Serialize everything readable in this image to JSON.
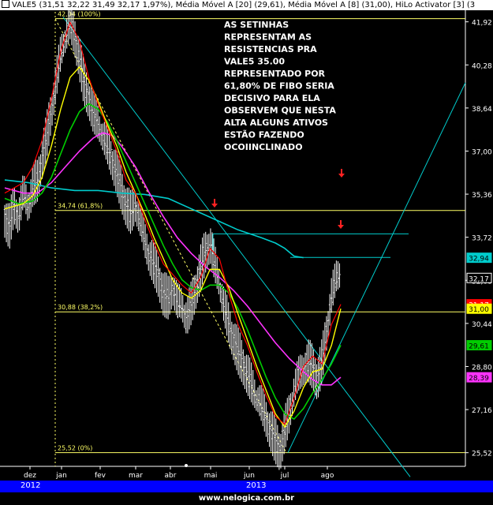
{
  "header": {
    "text": "VALE5 (31,51  32,22  31,49  32,17  1,97%), Média Móvel A [20] (29,61), Média Móvel A [8] (31,00), HiLo Activator [3] (3"
  },
  "annotation": {
    "lines": [
      "AS SETINHAS",
      "REPRESENTAM AS",
      "RESISTENCIAS PRA",
      "VALE5 35.00",
      "REPRESENTADO POR",
      "61,80% DE FIBO SERIA",
      "DECISIVO PARA ELA",
      "OBSERVEM QUE NESTA",
      "ALTA ALGUNS ATIVOS",
      "ESTÃO FAZENDO",
      "OCOIINCLINADO"
    ]
  },
  "year_bar": {
    "left": "2012",
    "center": "2013"
  },
  "footer": {
    "text": "www.nelogica.com.br"
  },
  "colors": {
    "price": "#ffffff",
    "hilo": "#ff0000",
    "ma8": "#ffff00",
    "ma20": "#00cc00",
    "ma_long": "#ff33ff",
    "ma_very_long": "#00cccc",
    "trend": "#00cccc",
    "fibo": "#ffff66",
    "arrow": "#ff2222"
  },
  "chart_data": {
    "type": "line",
    "ylim": [
      25.0,
      42.3
    ],
    "y_ticks": [
      "41,92",
      "40,28",
      "38,64",
      "37,00",
      "35,36",
      "33,72",
      "32,08",
      "30,44",
      "28,80",
      "27,16",
      "25,52"
    ],
    "y_tick_values": [
      41.92,
      40.28,
      38.64,
      37.0,
      35.36,
      33.72,
      32.08,
      30.44,
      28.8,
      27.16,
      25.52
    ],
    "x_ticks": [
      "dez",
      "jan",
      "fev",
      "mar",
      "abr",
      "mai",
      "jun",
      "jul",
      "ago"
    ],
    "price_tags": [
      {
        "label": "32,94",
        "value": 32.94,
        "bg": "#00cccc",
        "fg": "#000000"
      },
      {
        "label": "32,17",
        "value": 32.17,
        "bg": "#000000",
        "fg": "#ffffff"
      },
      {
        "label": "31,17",
        "value": 31.17,
        "bg": "#ff0000",
        "fg": "#ffffff"
      },
      {
        "label": "31,00",
        "value": 31.0,
        "bg": "#ffff00",
        "fg": "#000000"
      },
      {
        "label": "29,61",
        "value": 29.61,
        "bg": "#00cc00",
        "fg": "#000000"
      },
      {
        "label": "28,39",
        "value": 28.39,
        "bg": "#ff33ff",
        "fg": "#000000"
      }
    ],
    "fibo_levels": [
      {
        "label": "42,04 (100%)",
        "value": 42.04
      },
      {
        "label": "34,74 (61,8%)",
        "value": 34.74
      },
      {
        "label": "30,88 (38,2%)",
        "value": 30.88
      },
      {
        "label": "25,52 (0%)",
        "value": 25.52
      }
    ],
    "price_points": [
      [
        0,
        34.6
      ],
      [
        2,
        34.1
      ],
      [
        4,
        35.0
      ],
      [
        6,
        34.4
      ],
      [
        8,
        35.3
      ],
      [
        10,
        34.8
      ],
      [
        12,
        35.6
      ],
      [
        14,
        35.9
      ],
      [
        16,
        36.8
      ],
      [
        18,
        37.6
      ],
      [
        20,
        38.6
      ],
      [
        22,
        39.6
      ],
      [
        24,
        40.6
      ],
      [
        26,
        41.2
      ],
      [
        28,
        41.9
      ],
      [
        30,
        41.4
      ],
      [
        32,
        40.6
      ],
      [
        34,
        39.6
      ],
      [
        36,
        39.1
      ],
      [
        38,
        38.4
      ],
      [
        40,
        38.0
      ],
      [
        42,
        37.4
      ],
      [
        44,
        37.1
      ],
      [
        46,
        36.7
      ],
      [
        48,
        36.2
      ],
      [
        50,
        35.6
      ],
      [
        52,
        35.0
      ],
      [
        54,
        34.6
      ],
      [
        56,
        34.9
      ],
      [
        58,
        34.2
      ],
      [
        60,
        33.5
      ],
      [
        62,
        33.0
      ],
      [
        64,
        32.7
      ],
      [
        66,
        32.3
      ],
      [
        68,
        31.6
      ],
      [
        70,
        31.4
      ],
      [
        72,
        31.8
      ],
      [
        74,
        31.1
      ],
      [
        76,
        31.0
      ],
      [
        78,
        30.6
      ],
      [
        80,
        31.2
      ],
      [
        82,
        31.9
      ],
      [
        84,
        32.6
      ],
      [
        86,
        33.2
      ],
      [
        88,
        33.5
      ],
      [
        90,
        32.6
      ],
      [
        92,
        31.8
      ],
      [
        94,
        31.0
      ],
      [
        96,
        30.4
      ],
      [
        98,
        29.9
      ],
      [
        100,
        29.4
      ],
      [
        102,
        29.0
      ],
      [
        104,
        28.5
      ],
      [
        106,
        28.0
      ],
      [
        108,
        27.5
      ],
      [
        110,
        27.2
      ],
      [
        112,
        26.8
      ],
      [
        114,
        26.4
      ],
      [
        116,
        26.0
      ],
      [
        118,
        25.7
      ],
      [
        120,
        26.4
      ],
      [
        122,
        27.0
      ],
      [
        124,
        27.8
      ],
      [
        126,
        28.3
      ],
      [
        128,
        28.7
      ],
      [
        130,
        29.0
      ],
      [
        132,
        28.8
      ],
      [
        134,
        28.4
      ],
      [
        136,
        29.0
      ],
      [
        138,
        30.2
      ],
      [
        140,
        31.4
      ],
      [
        142,
        32.0
      ],
      [
        144,
        32.4
      ]
    ],
    "hilo_points": [
      [
        0,
        35.4
      ],
      [
        4,
        35.6
      ],
      [
        8,
        35.8
      ],
      [
        12,
        36.4
      ],
      [
        16,
        37.4
      ],
      [
        20,
        39.0
      ],
      [
        24,
        40.8
      ],
      [
        28,
        41.9
      ],
      [
        32,
        41.2
      ],
      [
        36,
        39.8
      ],
      [
        40,
        38.8
      ],
      [
        44,
        37.9
      ],
      [
        48,
        37.0
      ],
      [
        52,
        35.9
      ],
      [
        56,
        35.4
      ],
      [
        60,
        34.4
      ],
      [
        64,
        33.5
      ],
      [
        68,
        32.7
      ],
      [
        72,
        32.3
      ],
      [
        76,
        31.9
      ],
      [
        80,
        31.6
      ],
      [
        84,
        32.2
      ],
      [
        88,
        33.3
      ],
      [
        92,
        32.9
      ],
      [
        96,
        31.6
      ],
      [
        100,
        30.4
      ],
      [
        104,
        29.6
      ],
      [
        108,
        28.6
      ],
      [
        112,
        27.7
      ],
      [
        116,
        26.9
      ],
      [
        120,
        26.6
      ],
      [
        124,
        27.6
      ],
      [
        128,
        28.8
      ],
      [
        132,
        29.2
      ],
      [
        136,
        28.9
      ],
      [
        140,
        30.4
      ],
      [
        144,
        31.17
      ]
    ],
    "ma8_points": [
      [
        0,
        34.8
      ],
      [
        4,
        34.9
      ],
      [
        8,
        35.0
      ],
      [
        12,
        35.3
      ],
      [
        16,
        36.0
      ],
      [
        20,
        37.2
      ],
      [
        24,
        38.6
      ],
      [
        28,
        39.8
      ],
      [
        32,
        40.2
      ],
      [
        36,
        39.7
      ],
      [
        40,
        38.9
      ],
      [
        44,
        38.0
      ],
      [
        48,
        37.2
      ],
      [
        52,
        36.2
      ],
      [
        56,
        35.4
      ],
      [
        60,
        34.6
      ],
      [
        64,
        33.7
      ],
      [
        68,
        32.9
      ],
      [
        72,
        32.1
      ],
      [
        76,
        31.6
      ],
      [
        80,
        31.4
      ],
      [
        84,
        31.7
      ],
      [
        88,
        32.5
      ],
      [
        92,
        32.5
      ],
      [
        96,
        31.8
      ],
      [
        100,
        30.8
      ],
      [
        104,
        29.8
      ],
      [
        108,
        28.8
      ],
      [
        112,
        27.9
      ],
      [
        116,
        27.0
      ],
      [
        120,
        26.5
      ],
      [
        124,
        27.1
      ],
      [
        128,
        28.0
      ],
      [
        132,
        28.6
      ],
      [
        136,
        28.7
      ],
      [
        140,
        29.6
      ],
      [
        144,
        31.0
      ]
    ],
    "ma20_points": [
      [
        0,
        35.2
      ],
      [
        6,
        35.0
      ],
      [
        12,
        35.1
      ],
      [
        16,
        35.4
      ],
      [
        20,
        36.0
      ],
      [
        24,
        36.9
      ],
      [
        28,
        37.8
      ],
      [
        32,
        38.5
      ],
      [
        36,
        38.8
      ],
      [
        40,
        38.6
      ],
      [
        44,
        38.1
      ],
      [
        48,
        37.4
      ],
      [
        52,
        36.6
      ],
      [
        56,
        35.8
      ],
      [
        60,
        35.0
      ],
      [
        64,
        34.2
      ],
      [
        68,
        33.4
      ],
      [
        72,
        32.7
      ],
      [
        76,
        32.1
      ],
      [
        80,
        31.8
      ],
      [
        84,
        31.7
      ],
      [
        88,
        31.9
      ],
      [
        92,
        31.9
      ],
      [
        96,
        31.6
      ],
      [
        100,
        31.0
      ],
      [
        104,
        30.2
      ],
      [
        108,
        29.3
      ],
      [
        112,
        28.4
      ],
      [
        116,
        27.6
      ],
      [
        120,
        27.0
      ],
      [
        124,
        26.8
      ],
      [
        128,
        27.2
      ],
      [
        132,
        27.8
      ],
      [
        136,
        28.3
      ],
      [
        140,
        28.9
      ],
      [
        144,
        29.61
      ]
    ],
    "ma_long_points": [
      [
        0,
        35.6
      ],
      [
        8,
        35.4
      ],
      [
        14,
        35.4
      ],
      [
        20,
        35.8
      ],
      [
        26,
        36.4
      ],
      [
        32,
        37.0
      ],
      [
        38,
        37.5
      ],
      [
        42,
        37.7
      ],
      [
        46,
        37.6
      ],
      [
        50,
        37.2
      ],
      [
        56,
        36.4
      ],
      [
        62,
        35.4
      ],
      [
        68,
        34.5
      ],
      [
        74,
        33.7
      ],
      [
        80,
        33.1
      ],
      [
        86,
        32.6
      ],
      [
        92,
        32.2
      ],
      [
        98,
        31.7
      ],
      [
        104,
        31.1
      ],
      [
        110,
        30.4
      ],
      [
        116,
        29.7
      ],
      [
        122,
        29.1
      ],
      [
        128,
        28.6
      ],
      [
        132,
        28.3
      ],
      [
        136,
        28.1
      ],
      [
        140,
        28.1
      ],
      [
        144,
        28.39
      ]
    ],
    "ma_very_long_points": [
      [
        0,
        35.9
      ],
      [
        10,
        35.8
      ],
      [
        20,
        35.6
      ],
      [
        30,
        35.5
      ],
      [
        40,
        35.5
      ],
      [
        50,
        35.4
      ],
      [
        60,
        35.35
      ],
      [
        70,
        35.2
      ],
      [
        80,
        34.8
      ],
      [
        90,
        34.4
      ],
      [
        100,
        34.0
      ],
      [
        110,
        33.7
      ],
      [
        116,
        33.5
      ],
      [
        120,
        33.3
      ],
      [
        124,
        33.0
      ],
      [
        128,
        32.94
      ]
    ]
  }
}
